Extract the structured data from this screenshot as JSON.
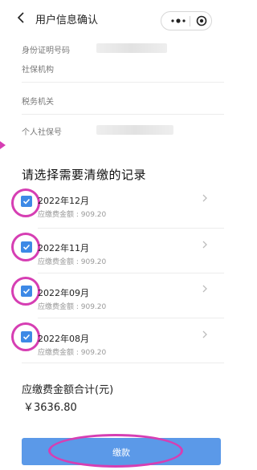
{
  "header": {
    "title": "用户信息确认"
  },
  "info": {
    "id_label": "身份证明号码",
    "org_label": "社保机构",
    "tax_label": "税务机关",
    "personal_no_label": "个人社保号"
  },
  "section_title": "请选择需要清缴的记录",
  "records": [
    {
      "title": "2022年12月",
      "amount": "应缴费金额 : 909.20",
      "checked": true
    },
    {
      "title": "2022年11月",
      "amount": "应缴费金额 : 909.20",
      "checked": true
    },
    {
      "title": "2022年09月",
      "amount": "应缴费金额 : 909.20",
      "checked": true
    },
    {
      "title": "2022年08月",
      "amount": "应缴费金额 : 909.20",
      "checked": true
    }
  ],
  "total": {
    "label": "应缴费金额合计(元)",
    "value": "￥3636.80"
  },
  "pay_button": {
    "label": "缴款"
  },
  "colors": {
    "accent": "#3d89e6",
    "button": "#5b99e8",
    "annotation": "#d63eb3"
  },
  "icons": [
    "back-icon",
    "more-icon",
    "target-icon",
    "checkbox-checked-icon",
    "chevron-right-icon"
  ]
}
